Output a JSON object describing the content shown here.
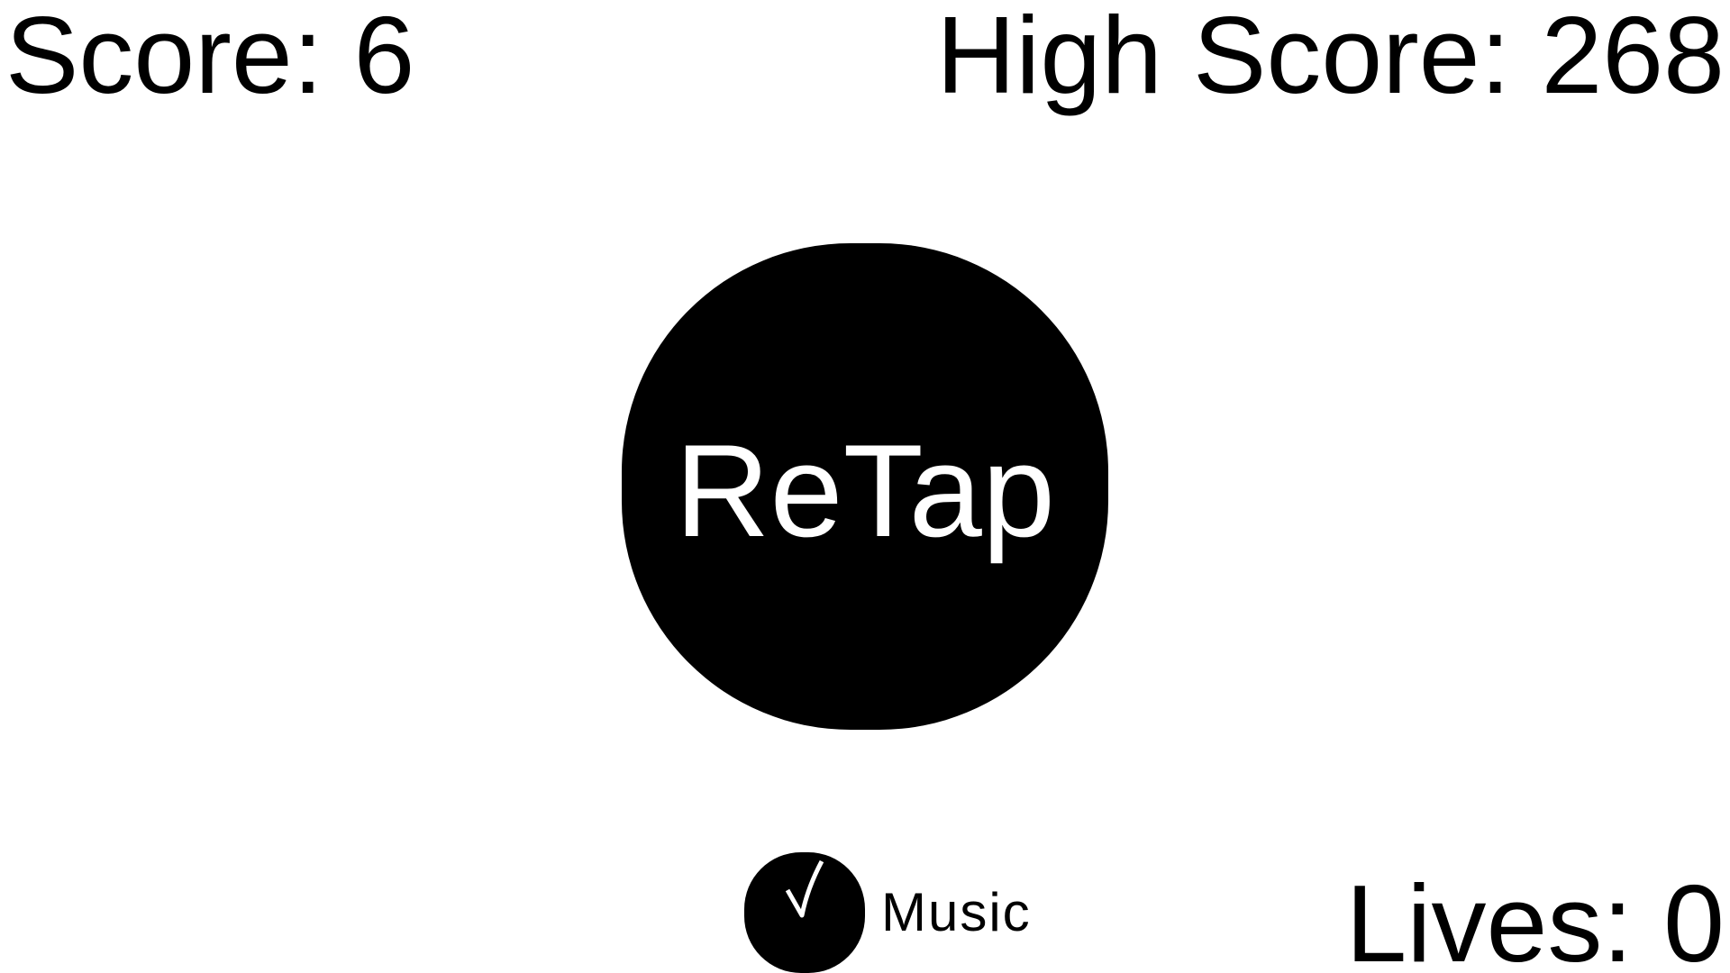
{
  "hud": {
    "score_text": "Score: 6",
    "high_score_text": "High Score: 268",
    "lives_text": "Lives: 0"
  },
  "game": {
    "retap_label": "ReTap"
  },
  "music": {
    "label": "Music",
    "icon": "check-icon",
    "enabled": true
  },
  "colors": {
    "background": "#ffffff",
    "foreground": "#000000",
    "button_text": "#ffffff"
  }
}
